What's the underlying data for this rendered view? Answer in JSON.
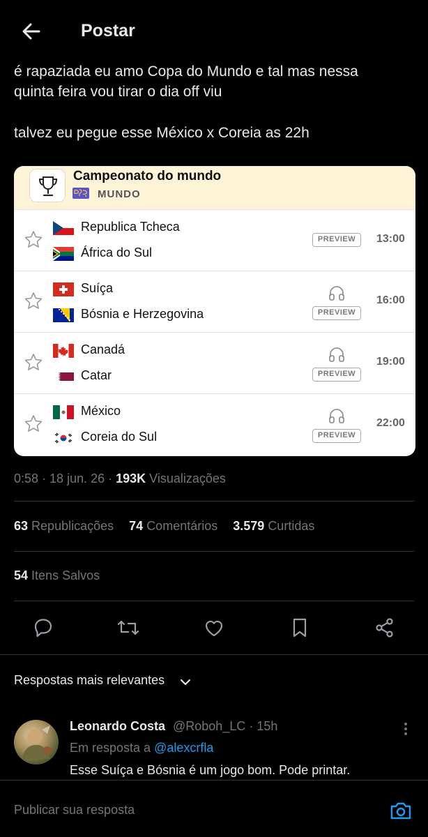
{
  "header": {
    "title": "Postar",
    "back_icon": "arrow-left-icon"
  },
  "post": {
    "lines": [
      "é rapaziada eu amo Copa do Mundo e tal mas nessa",
      "quinta feira vou tirar o dia off viu",
      "talvez eu pegue esse México x Coreia as 22h"
    ]
  },
  "card": {
    "title": "Campeonato do mundo",
    "subtitle": "MUNDO",
    "preview_label": "PREVIEW",
    "matches": [
      {
        "team1": "Republica Tcheca",
        "team2": "África do Sul",
        "time": "13:00",
        "has_audio": false
      },
      {
        "team1": "Suíça",
        "team2": "Bósnia e Herzegovina",
        "time": "16:00",
        "has_audio": true
      },
      {
        "team1": "Canadá",
        "team2": "Catar",
        "time": "19:00",
        "has_audio": true
      },
      {
        "team1": "México",
        "team2": "Coreia do Sul",
        "time": "22:00",
        "has_audio": true
      }
    ]
  },
  "meta": {
    "time": "0:58",
    "date": "18 jun. 26",
    "views_count": "193K",
    "views_label": "Visualizações"
  },
  "stats": {
    "reposts_count": "63",
    "reposts_label": "Republicações",
    "comments_count": "74",
    "comments_label": "Comentários",
    "likes_count": "3.579",
    "likes_label": "Curtidas",
    "saved_count": "54",
    "saved_label": "Itens Salvos"
  },
  "actions": [
    "reply-icon",
    "repost-icon",
    "like-icon",
    "bookmark-icon",
    "share-icon"
  ],
  "replies": {
    "sort_label": "Respostas mais relevantes",
    "items": [
      {
        "name": "Leonardo Costa",
        "handle": "@Roboh_LC · 15h",
        "in_reply_prefix": "Em resposta a",
        "in_reply_mention": "@alexcrfla",
        "text": "Esse Suíça e Bósnia é um jogo bom. Pode printar."
      }
    ]
  },
  "compose": {
    "placeholder": "Publicar sua resposta"
  },
  "colors": {
    "background": "#000000",
    "accent": "#1d9bf0",
    "muted": "#71767b",
    "card_header": "#fdf3d6"
  }
}
